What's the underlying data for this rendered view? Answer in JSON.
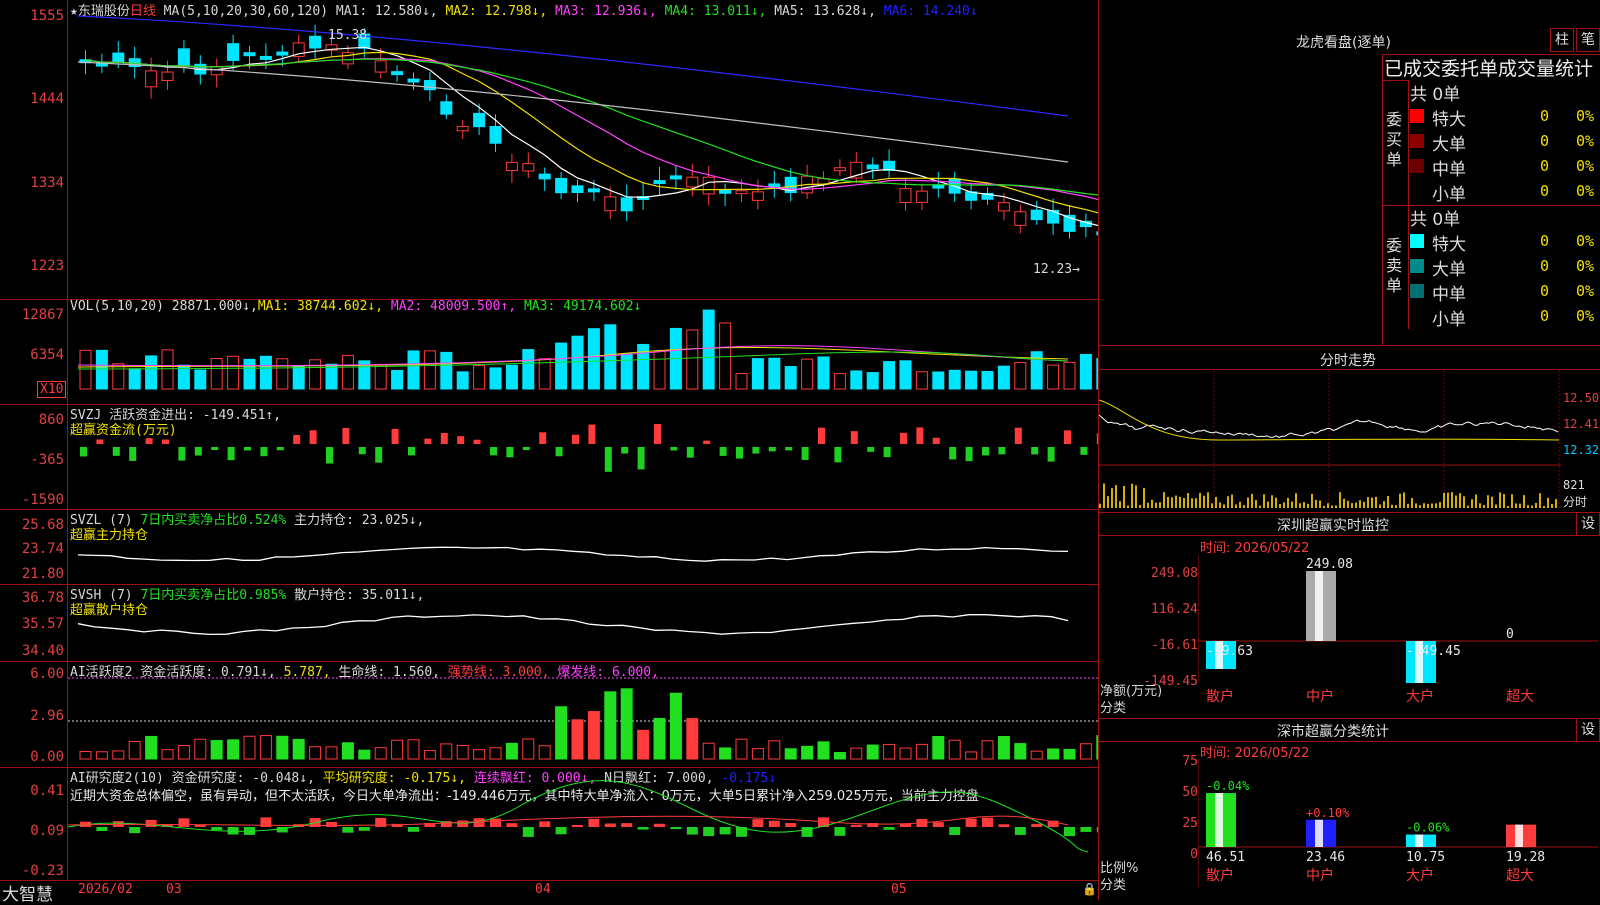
{
  "header": {
    "stock": "★东瑞股份",
    "period": "日线",
    "ma_label": "MA(5,10,20,30,60,120)",
    "ma1": "MA1: 12.580↓,",
    "ma2": "MA2: 12.798↓,",
    "ma3": "MA3: 12.936↓,",
    "ma4": "MA4: 13.011↓,",
    "ma5": "MA5: 13.628↓,",
    "ma6": "MA6: 14.240↓"
  },
  "price_axis": [
    "1555",
    "1444",
    "1334",
    "1223"
  ],
  "price_high_marker": "15.38",
  "price_low_marker": "12.23→",
  "vol": {
    "label": "VOL(5,10,20)",
    "value": "28871.000↓,",
    "ma1": "MA1: 38744.602↓,",
    "ma2": "MA2: 48009.500↑,",
    "ma3": "MA3: 49174.602↓",
    "axis": [
      "12867",
      "6354"
    ],
    "unit": "X10"
  },
  "svzj": {
    "line1a": "SVZJ",
    "line1b": "活跃资金进出: -149.451↑,",
    "line2": "超赢资金流(万元)",
    "axis": [
      "860",
      "-365",
      "-1590"
    ]
  },
  "svzl": {
    "name": "SVZL (7)",
    "desc": "7日内买卖净占比0.524%",
    "hold": "主力持仓: 23.025↓,",
    "line2": "超赢主力持仓",
    "axis": [
      "25.68",
      "23.74",
      "21.80"
    ]
  },
  "svsh": {
    "name": "SVSH (7)",
    "desc": "7日内买卖净占比0.985%",
    "hold": "散户持仓: 35.011↓,",
    "line2": "超赢散户持仓",
    "axis": [
      "36.78",
      "35.57",
      "34.40"
    ]
  },
  "ai1": {
    "name": "AI活跃度2",
    "a": "资金活跃度: 0.791↓,",
    "b": "5.787,",
    "c": "生命线: 1.560,",
    "d": "强势线: 3.000,",
    "e": "爆发线: 6.000,",
    "axis": [
      "6.00",
      "2.96",
      "0.00"
    ]
  },
  "ai2": {
    "name": "AI研究度2(10)",
    "a": "资金研究度: -0.048↓,",
    "b": "平均研究度: -0.175↓,",
    "c": "连续飘红: 0.000↓,",
    "d": "N日飘红: 7.000,",
    "e": "-0.175↓",
    "text": "近期大资金总体偏空，虽有异动，但不太活跃，今日大单净流出：-149.446万元，其中特大单净流入：0万元，大单5日累计净入259.025万元，当前主力控盘",
    "axis": [
      "0.41",
      "0.09",
      "-0.23"
    ]
  },
  "footer": {
    "brand": "大智慧",
    "dates": [
      "2026/02",
      "03",
      "04",
      "05"
    ]
  },
  "lhb": {
    "title": "龙虎看盘(逐单)",
    "btn_bar": "柱",
    "btn_pen": "笔",
    "subtitle": "已成交委托单成交量统计",
    "buy_label": "委买单",
    "sell_label": "委卖单",
    "buy_total": "共 0单",
    "sell_total": "共 0单",
    "rows": [
      "特大",
      "大单",
      "中单",
      "小单"
    ],
    "values": [
      "0",
      "0",
      "0",
      "0"
    ],
    "pcts": [
      "0%",
      "0%",
      "0%",
      "0%"
    ],
    "buy_colors": [
      "#ff0000",
      "#8b0000",
      "#6b0000",
      "#000000"
    ],
    "sell_colors": [
      "#00ffff",
      "#008b8b",
      "#007070",
      "#000000"
    ]
  },
  "intraday": {
    "title": "分时走势",
    "axis": [
      "12.50",
      "12.41",
      "12.32"
    ],
    "vol_value": "821",
    "vol_label": "分时"
  },
  "sz_monitor": {
    "title": "深圳超赢实时监控",
    "btn": "设",
    "time": "时间: 2026/05/22",
    "axis": [
      "249.08",
      "116.24",
      "-16.61",
      "-149.45"
    ],
    "y_label1": "净额(万元)",
    "y_label2": "分类",
    "categories": [
      "散户",
      "中户",
      "大户",
      "超大"
    ],
    "values": [
      -99.63,
      249.08,
      -149.45,
      0
    ],
    "value_labels": [
      "-99.63",
      "249.08",
      "-149.45",
      "0"
    ]
  },
  "sz_class": {
    "title": "深市超赢分类统计",
    "btn": "设",
    "time": "时间: 2026/05/22",
    "axis": [
      "75",
      "50",
      "25",
      "0"
    ],
    "y_label1": "比例%",
    "y_label2": "分类",
    "categories": [
      "散户",
      "中户",
      "大户",
      "超大"
    ],
    "values": [
      46.51,
      23.46,
      10.75,
      19.28
    ],
    "value_labels": [
      "46.51",
      "23.46",
      "10.75",
      "19.28"
    ],
    "change_labels": [
      "-0.04%",
      "+0.10%",
      "-0.06%",
      ""
    ]
  },
  "colors": {
    "up": "#ff3b3b",
    "down": "#00e5ff",
    "border": "#a01010",
    "ma1": "#ffffff",
    "ma2": "#f0e000",
    "ma3": "#ff40ff",
    "ma4": "#20e020",
    "ma5": "#c0c0c0",
    "ma6": "#2a2aff"
  }
}
